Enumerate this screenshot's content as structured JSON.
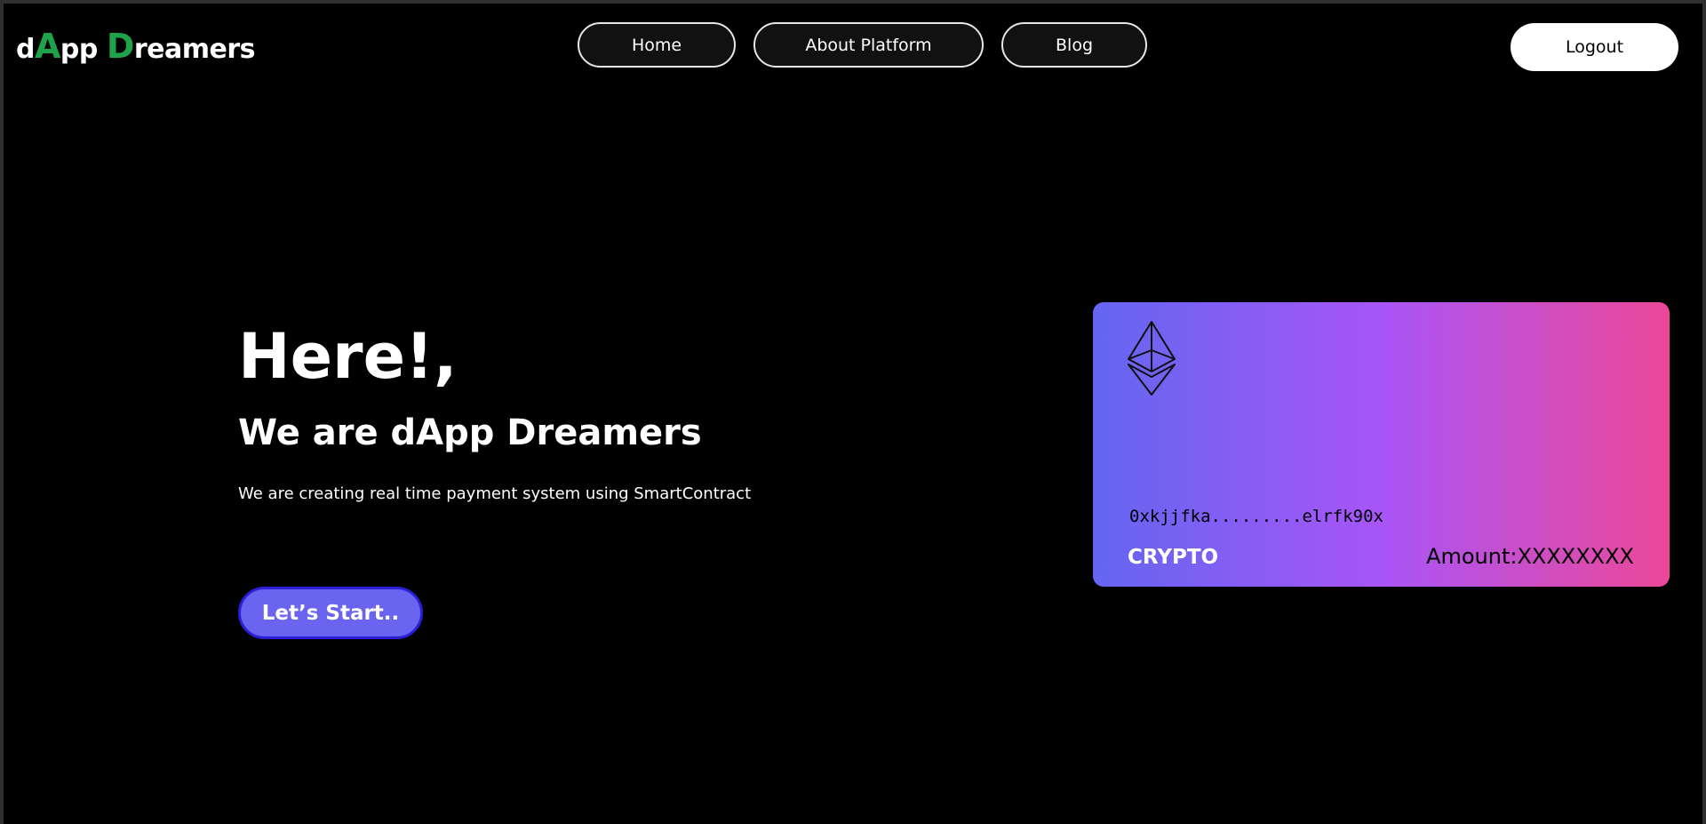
{
  "header": {
    "logo": {
      "part1": "d",
      "part2": "A",
      "part3": "pp ",
      "part4": "D",
      "part5": "reamers"
    },
    "nav": {
      "home": "Home",
      "about": "About Platform",
      "blog": "Blog"
    },
    "logout_label": "Logout"
  },
  "hero": {
    "title": "Here!,",
    "subtitle": "We are dApp Dreamers",
    "description": "We are creating real time payment system using SmartContract",
    "cta_label": "Let’s Start.."
  },
  "card": {
    "icon": "ethereum-icon",
    "address": "0xkjjfka.........elrfk90x",
    "label": "CRYPTO",
    "amount": "Amount:XXXXXXXX"
  },
  "colors": {
    "background": "#000000",
    "logo_accent": "#1fa34a",
    "cta_background": "#6a64f0",
    "card_gradient_start": "#6366f1",
    "card_gradient_mid": "#a855f7",
    "card_gradient_end": "#ec4899"
  }
}
